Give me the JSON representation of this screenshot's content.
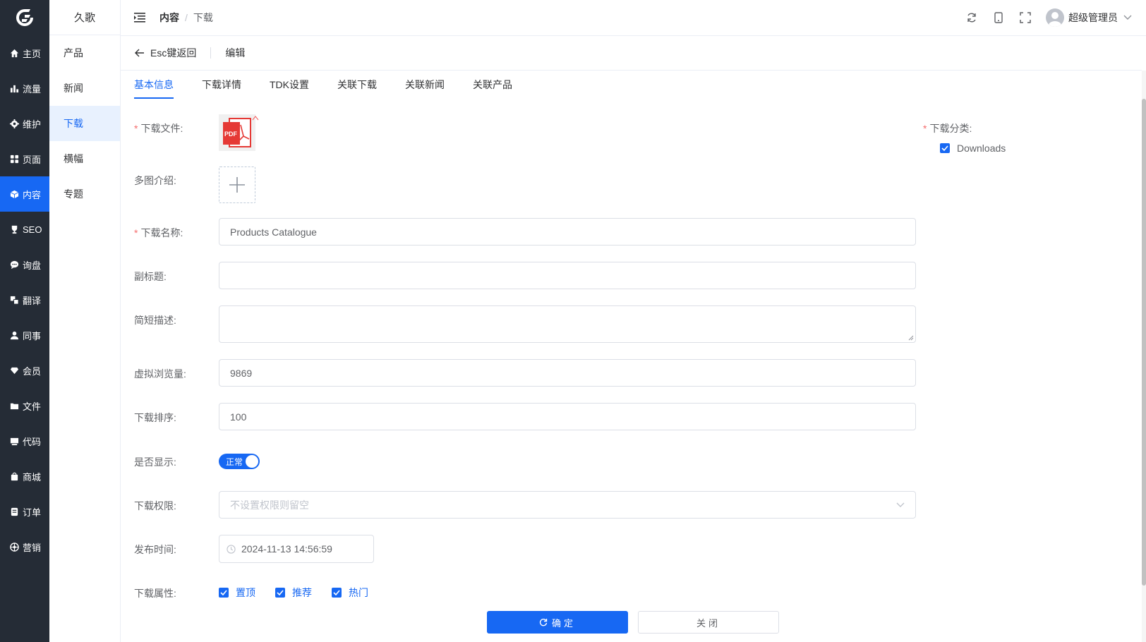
{
  "rail": {
    "items": [
      {
        "label": "主页",
        "icon": "home-icon"
      },
      {
        "label": "流量",
        "icon": "bar-chart-icon"
      },
      {
        "label": "维护",
        "icon": "gear-icon"
      },
      {
        "label": "页面",
        "icon": "grid-icon"
      },
      {
        "label": "内容",
        "icon": "cube-icon",
        "active": true
      },
      {
        "label": "SEO",
        "icon": "trophy-icon"
      },
      {
        "label": "询盘",
        "icon": "chat-icon"
      },
      {
        "label": "翻译",
        "icon": "translate-icon"
      },
      {
        "label": "同事",
        "icon": "person-icon"
      },
      {
        "label": "会员",
        "icon": "diamond-icon"
      },
      {
        "label": "文件",
        "icon": "folder-icon"
      },
      {
        "label": "代码",
        "icon": "code-icon"
      },
      {
        "label": "商城",
        "icon": "bag-icon"
      },
      {
        "label": "订单",
        "icon": "order-icon"
      },
      {
        "label": "营销",
        "icon": "marketing-icon"
      }
    ]
  },
  "sub": {
    "title": "久歌",
    "items": [
      {
        "label": "产品"
      },
      {
        "label": "新闻"
      },
      {
        "label": "下载",
        "active": true
      },
      {
        "label": "横幅"
      },
      {
        "label": "专题"
      }
    ]
  },
  "header": {
    "crumb1": "内容",
    "crumb_sep": "/",
    "crumb2": "下载",
    "username": "超级管理员"
  },
  "pagehead": {
    "back": "Esc键返回",
    "title": "编辑"
  },
  "tabs": [
    "基本信息",
    "下载详情",
    "TDK设置",
    "关联下载",
    "关联新闻",
    "关联产品"
  ],
  "form": {
    "file_label": "下载文件:",
    "pdf_text": "PDF",
    "gallery_label": "多图介绍:",
    "name_label": "下载名称:",
    "name_value": "Products Catalogue",
    "subtitle_label": "副标题:",
    "subtitle_value": "",
    "desc_label": "简短描述:",
    "desc_value": "",
    "views_label": "虚拟浏览量:",
    "views_value": "9869",
    "sort_label": "下载排序:",
    "sort_value": "100",
    "show_label": "是否显示:",
    "show_value": "正常",
    "perm_label": "下载权限:",
    "perm_placeholder": "不设置权限则留空",
    "time_label": "发布时间:",
    "time_value": "2024-11-13 14:56:59",
    "attr_label": "下载属性:",
    "attrs": [
      "置顶",
      "推荐",
      "热门"
    ],
    "category_label": "下载分类:",
    "category_value": "Downloads"
  },
  "actions": {
    "ok": "确定",
    "close": "关闭"
  },
  "colors": {
    "accent": "#1768f3",
    "rail_bg": "#252c36",
    "pdf_red": "#e53935"
  }
}
